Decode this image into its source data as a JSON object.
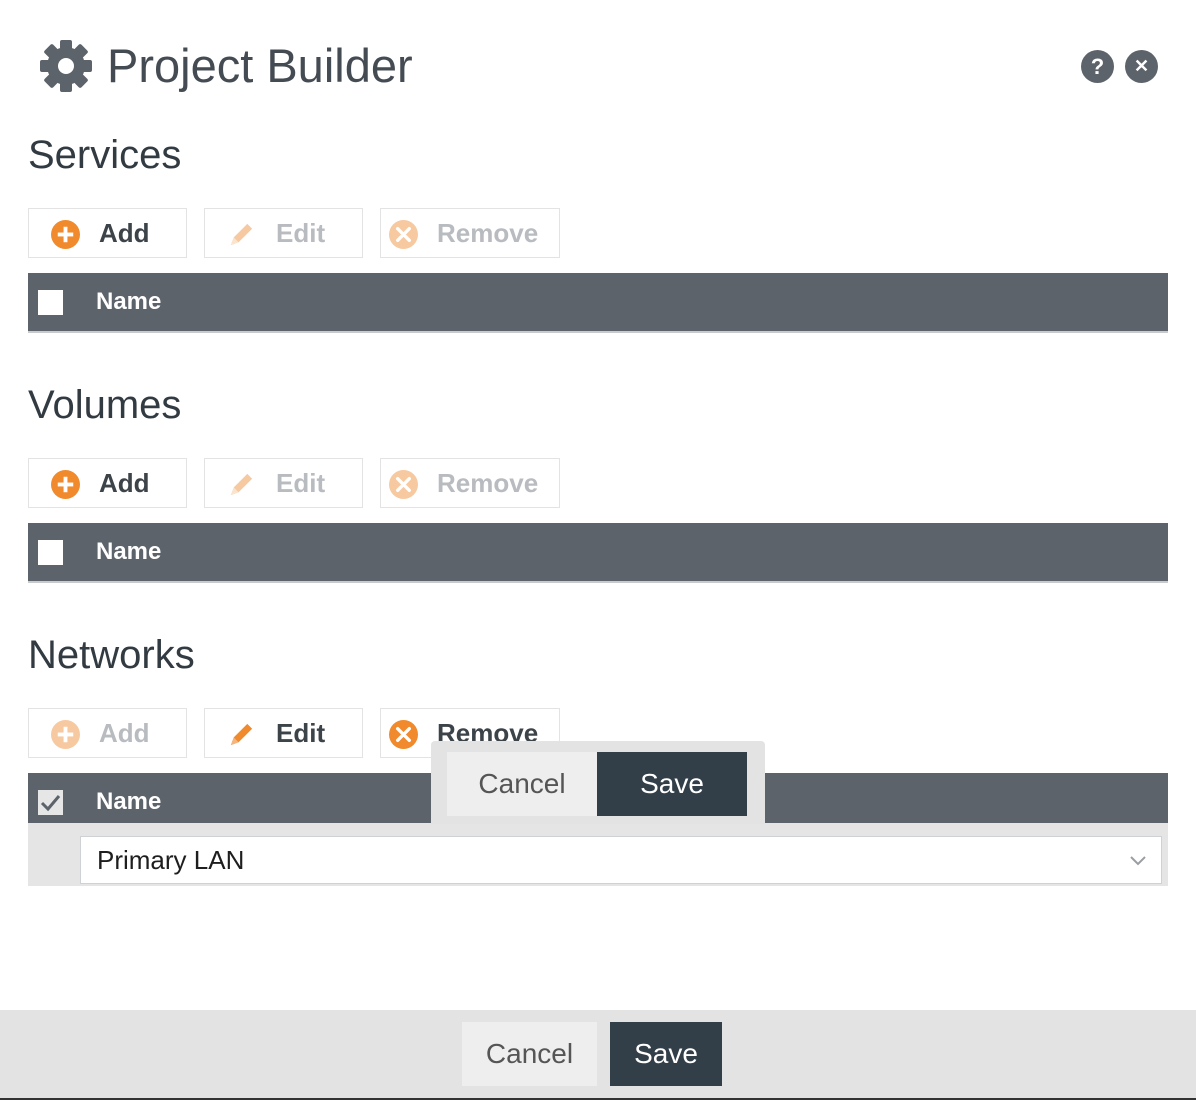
{
  "header": {
    "title": "Project Builder",
    "help_label": "?",
    "close_label": "✕"
  },
  "colors": {
    "accent": "#f08a2c",
    "dark": "#323e48",
    "grid_header": "#5d636a"
  },
  "sections": {
    "services": {
      "title": "Services",
      "add_label": "Add",
      "edit_label": "Edit",
      "remove_label": "Remove",
      "column_name": "Name"
    },
    "volumes": {
      "title": "Volumes",
      "add_label": "Add",
      "edit_label": "Edit",
      "remove_label": "Remove",
      "column_name": "Name"
    },
    "networks": {
      "title": "Networks",
      "add_label": "Add",
      "edit_label": "Edit",
      "remove_label": "Remove",
      "column_name": "Name",
      "editor_value": "Primary LAN",
      "row_cancel": "Cancel",
      "row_save": "Save"
    }
  },
  "footer": {
    "cancel_label": "Cancel",
    "save_label": "Save"
  }
}
